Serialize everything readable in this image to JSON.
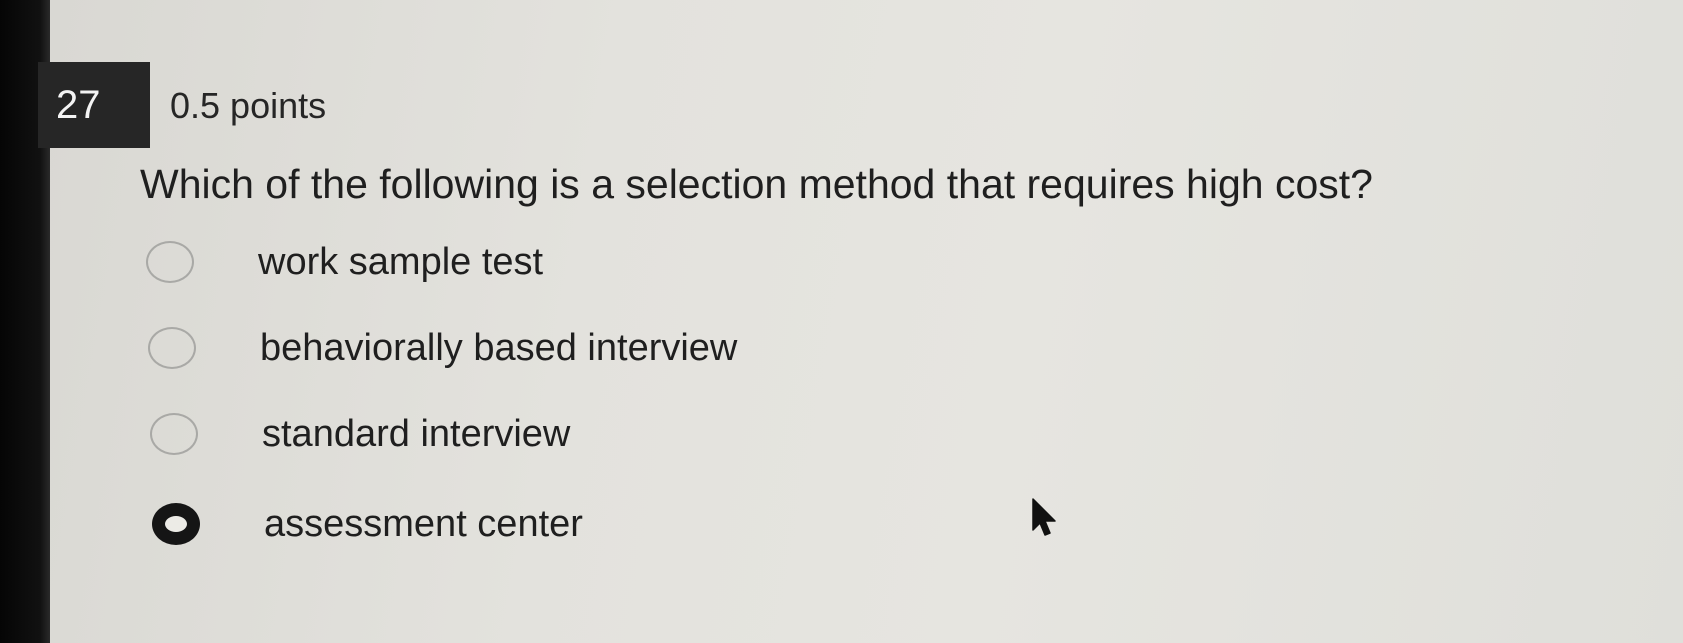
{
  "question": {
    "number": "27",
    "points": "0.5 points",
    "text": "Which of the following is a selection method that requires high cost?"
  },
  "options": [
    {
      "label": "work sample test",
      "selected": false
    },
    {
      "label": "behaviorally based interview",
      "selected": false
    },
    {
      "label": "standard interview",
      "selected": false
    },
    {
      "label": "assessment center",
      "selected": true
    }
  ],
  "colors": {
    "background": "#e3e2dd",
    "number_badge": "#262626",
    "text": "#1f1f1f",
    "radio_border": "#a9a9a6",
    "radio_selected": "#151515"
  },
  "icons": [
    "radio-unselected-icon",
    "radio-selected-icon",
    "mouse-pointer-icon"
  ]
}
